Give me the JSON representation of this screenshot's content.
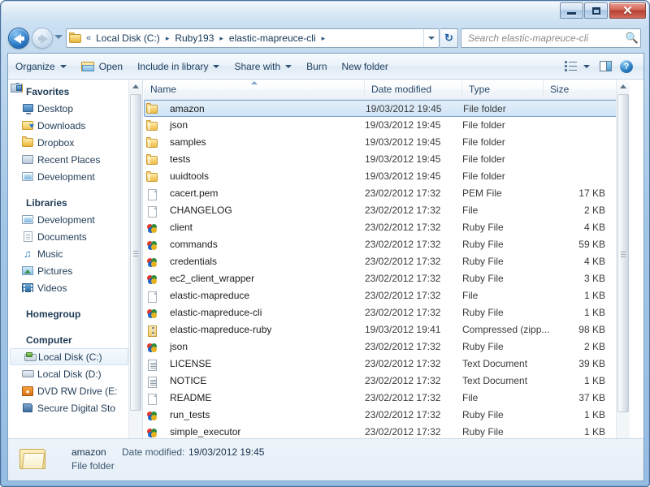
{
  "window": {
    "title": "",
    "caption_buttons": [
      {
        "name": "minimize",
        "glyph": "minimize-icon"
      },
      {
        "name": "maximize",
        "glyph": "maximize-icon"
      },
      {
        "name": "close",
        "glyph": "✕"
      }
    ]
  },
  "navigation": {
    "back_label": "Back",
    "forward_label": "Forward",
    "history_label": "Recent pages",
    "breadcrumb_prefix": "«",
    "breadcrumbs": [
      "Local Disk (C:)",
      "Ruby193",
      "elastic-mapreuce-cli"
    ],
    "breadcrumb_separator": "▸",
    "refresh_label": "↻"
  },
  "search": {
    "placeholder": "Search elastic-mapreuce-cli",
    "value": "",
    "icon": "search-icon"
  },
  "commandbar": {
    "items": [
      {
        "label": "Organize",
        "has_caret": true,
        "icon": null
      },
      {
        "label": "Open",
        "has_caret": false,
        "icon": "open-folder-icon"
      },
      {
        "label": "Include in library",
        "has_caret": true,
        "icon": null
      },
      {
        "label": "Share with",
        "has_caret": true,
        "icon": null
      },
      {
        "label": "Burn",
        "has_caret": false,
        "icon": null
      },
      {
        "label": "New folder",
        "has_caret": false,
        "icon": null
      }
    ],
    "views_label": "Change your view",
    "preview_label": "Show the preview pane",
    "help_label": "?"
  },
  "sidebar": {
    "groups": [
      {
        "name": "Favorites",
        "icon": "star-icon",
        "items": [
          {
            "label": "Desktop",
            "icon": "desktop-icon"
          },
          {
            "label": "Downloads",
            "icon": "downloads-icon"
          },
          {
            "label": "Dropbox",
            "icon": "folder-icon"
          },
          {
            "label": "Recent Places",
            "icon": "recent-places-icon"
          },
          {
            "label": "Development",
            "icon": "library-icon"
          }
        ]
      },
      {
        "name": "Libraries",
        "icon": "libraries-icon",
        "items": [
          {
            "label": "Development",
            "icon": "library-icon"
          },
          {
            "label": "Documents",
            "icon": "document-library-icon"
          },
          {
            "label": "Music",
            "icon": "music-icon"
          },
          {
            "label": "Pictures",
            "icon": "pictures-icon"
          },
          {
            "label": "Videos",
            "icon": "videos-icon"
          }
        ]
      },
      {
        "name": "Homegroup",
        "icon": "homegroup-icon",
        "items": []
      },
      {
        "name": "Computer",
        "icon": "computer-icon",
        "items": [
          {
            "label": "Local Disk (C:)",
            "icon": "system-drive-icon",
            "selected": true
          },
          {
            "label": "Local Disk (D:)",
            "icon": "drive-icon"
          },
          {
            "label": "DVD RW Drive (E:",
            "icon": "dvd-drive-icon"
          },
          {
            "label": "Secure Digital Sto",
            "icon": "sd-card-icon"
          }
        ]
      }
    ]
  },
  "filelist": {
    "columns": [
      {
        "key": "name",
        "label": "Name",
        "sorted": "asc"
      },
      {
        "key": "date",
        "label": "Date modified"
      },
      {
        "key": "type",
        "label": "Type"
      },
      {
        "key": "size",
        "label": "Size"
      }
    ],
    "rows": [
      {
        "name": "amazon",
        "date": "19/03/2012 19:45",
        "type": "File folder",
        "size": "",
        "icon": "folder-icon",
        "selected": true
      },
      {
        "name": "json",
        "date": "19/03/2012 19:45",
        "type": "File folder",
        "size": "",
        "icon": "folder-icon"
      },
      {
        "name": "samples",
        "date": "19/03/2012 19:45",
        "type": "File folder",
        "size": "",
        "icon": "folder-icon"
      },
      {
        "name": "tests",
        "date": "19/03/2012 19:45",
        "type": "File folder",
        "size": "",
        "icon": "folder-icon"
      },
      {
        "name": "uuidtools",
        "date": "19/03/2012 19:45",
        "type": "File folder",
        "size": "",
        "icon": "folder-icon"
      },
      {
        "name": "cacert.pem",
        "date": "23/02/2012 17:32",
        "type": "PEM File",
        "size": "17 KB",
        "icon": "file-icon"
      },
      {
        "name": "CHANGELOG",
        "date": "23/02/2012 17:32",
        "type": "File",
        "size": "2 KB",
        "icon": "file-icon"
      },
      {
        "name": "client",
        "date": "23/02/2012 17:32",
        "type": "Ruby File",
        "size": "4 KB",
        "icon": "ruby-file-icon"
      },
      {
        "name": "commands",
        "date": "23/02/2012 17:32",
        "type": "Ruby File",
        "size": "59 KB",
        "icon": "ruby-file-icon"
      },
      {
        "name": "credentials",
        "date": "23/02/2012 17:32",
        "type": "Ruby File",
        "size": "4 KB",
        "icon": "ruby-file-icon"
      },
      {
        "name": "ec2_client_wrapper",
        "date": "23/02/2012 17:32",
        "type": "Ruby File",
        "size": "3 KB",
        "icon": "ruby-file-icon"
      },
      {
        "name": "elastic-mapreduce",
        "date": "23/02/2012 17:32",
        "type": "File",
        "size": "1 KB",
        "icon": "file-icon"
      },
      {
        "name": "elastic-mapreduce-cli",
        "date": "23/02/2012 17:32",
        "type": "Ruby File",
        "size": "1 KB",
        "icon": "ruby-file-icon"
      },
      {
        "name": "elastic-mapreduce-ruby",
        "date": "19/03/2012 19:41",
        "type": "Compressed (zipp...",
        "size": "98 KB",
        "icon": "zip-file-icon"
      },
      {
        "name": "json",
        "date": "23/02/2012 17:32",
        "type": "Ruby File",
        "size": "2 KB",
        "icon": "ruby-file-icon"
      },
      {
        "name": "LICENSE",
        "date": "23/02/2012 17:32",
        "type": "Text Document",
        "size": "39 KB",
        "icon": "text-file-icon"
      },
      {
        "name": "NOTICE",
        "date": "23/02/2012 17:32",
        "type": "Text Document",
        "size": "1 KB",
        "icon": "text-file-icon"
      },
      {
        "name": "README",
        "date": "23/02/2012 17:32",
        "type": "File",
        "size": "37 KB",
        "icon": "file-icon"
      },
      {
        "name": "run_tests",
        "date": "23/02/2012 17:32",
        "type": "Ruby File",
        "size": "1 KB",
        "icon": "ruby-file-icon"
      },
      {
        "name": "simple_executor",
        "date": "23/02/2012 17:32",
        "type": "Ruby File",
        "size": "1 KB",
        "icon": "ruby-file-icon"
      }
    ]
  },
  "details": {
    "name": "amazon",
    "date_label": "Date modified:",
    "date_value": "19/03/2012 19:45",
    "kind": "File folder",
    "icon": "open-folder-large-icon"
  },
  "colors": {
    "selection_border": "#7da2c6",
    "selection_fill": "#cfe4f6",
    "accent": "#2c7fc4",
    "folder_yellow": "#f6d272",
    "close_red": "#b53f31"
  }
}
